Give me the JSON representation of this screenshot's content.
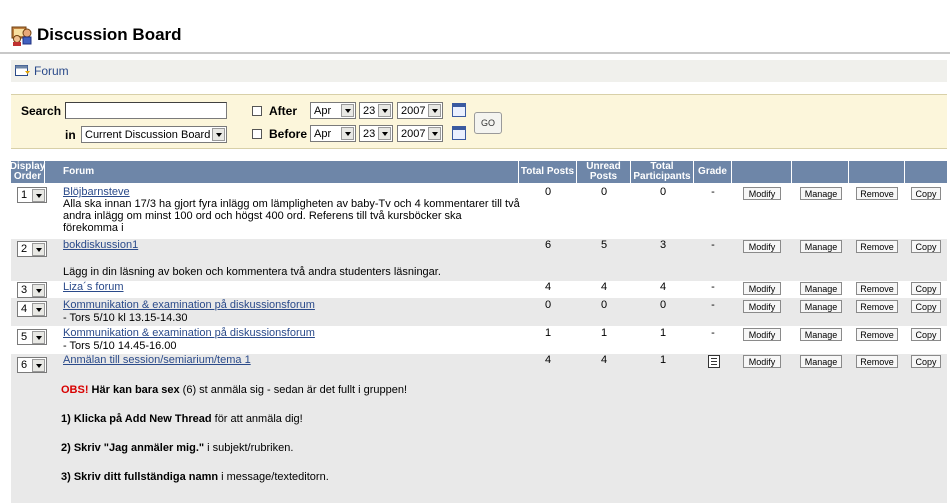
{
  "header": {
    "title": "Discussion Board"
  },
  "breadcrumb": {
    "label": "Forum"
  },
  "search": {
    "label": "Search",
    "query_value": "",
    "in_label": "in",
    "scope": "Current Discussion Board",
    "after_label": "After",
    "after": {
      "month": "Apr",
      "day": "23",
      "year": "2007"
    },
    "before_label": "Before",
    "before": {
      "month": "Apr",
      "day": "23",
      "year": "2007"
    },
    "go_label": "GO"
  },
  "table": {
    "headers": {
      "display_order_1": "Display",
      "display_order_2": "Order",
      "forum": "Forum",
      "total_posts": "Total Posts",
      "unread_1": "Unread",
      "unread_2": "Posts",
      "total_part_1": "Total",
      "total_part_2": "Participants",
      "grade": "Grade"
    },
    "actions": {
      "modify": "Modify",
      "manage": "Manage",
      "remove": "Remove",
      "copy": "Copy"
    },
    "rows": [
      {
        "order": "1",
        "title": "Blöjbarnsteve",
        "desc_lines": [
          "Alla ska innan 17/3 ha gjort fyra inlägg om lämpligheten av baby-Tv och 4 kommentarer till två",
          "andra inlägg om minst 100 ord och högst 400 ord. Referens till två kursböcker ska",
          "förekomma i"
        ],
        "total_posts": "0",
        "unread": "0",
        "participants": "0",
        "grade": "-"
      },
      {
        "order": "2",
        "title": "bokdiskussion1",
        "desc_lines": [
          "Lägg in din läsning av boken och kommentera två andra studenters läsningar."
        ],
        "total_posts": "6",
        "unread": "5",
        "participants": "3",
        "grade": "-"
      },
      {
        "order": "3",
        "title": "Liza´s forum",
        "desc_lines": [],
        "total_posts": "4",
        "unread": "4",
        "participants": "4",
        "grade": "-"
      },
      {
        "order": "4",
        "title": "Kommunikation & examination på diskussionsforum",
        "desc_lines": [
          "- Tors 5/10 kl 13.15-14.30"
        ],
        "total_posts": "0",
        "unread": "0",
        "participants": "0",
        "grade": "-"
      },
      {
        "order": "5",
        "title": "Kommunikation & examination på diskussionsforum",
        "desc_lines": [
          "- Tors 5/10 14.45-16.00"
        ],
        "total_posts": "1",
        "unread": "1",
        "participants": "1",
        "grade": "-"
      },
      {
        "order": "6",
        "title": "Anmälan till session/semiarium/tema 1",
        "desc_lines": [],
        "total_posts": "4",
        "unread": "4",
        "participants": "1",
        "grade": ""
      }
    ],
    "notes": {
      "n1_red": "OBS!",
      "n1_bold": " Här kan bara sex",
      "n1_rest": " (6) st anmäla sig - sedan är det fullt i gruppen!",
      "n2_bold": "1) Klicka på Add New Thread",
      "n2_rest": " för att anmäla dig!",
      "n3_bold": "2) Skriv \"Jag anmäler mig.\"",
      "n3_rest": " i subjekt/rubriken.",
      "n4_bold": "3) Skriv ditt fullständiga namn",
      "n4_rest": " i message/texteditorn."
    }
  }
}
